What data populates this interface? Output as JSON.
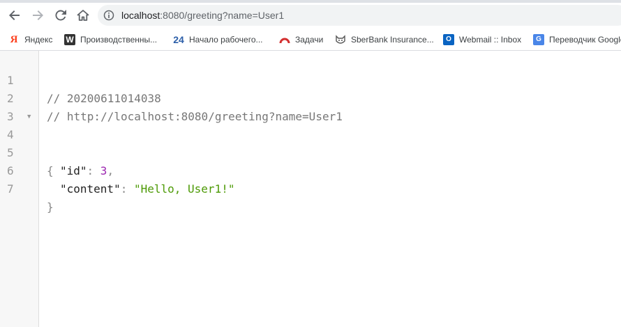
{
  "browser": {
    "url_host": "localhost",
    "url_path": ":8080/greeting?name=User1"
  },
  "bookmarks": [
    {
      "label": "Яндекс",
      "icon": "yandex-icon"
    },
    {
      "label": "Производственны...",
      "icon": "w-icon"
    },
    {
      "label": "Начало рабочего...",
      "icon": "bitrix24-icon"
    },
    {
      "label": "Задачи",
      "icon": "tasks-arc-icon"
    },
    {
      "label": "SberBank Insurance...",
      "icon": "cat-icon"
    },
    {
      "label": "Webmail :: Inbox",
      "icon": "outlook-icon"
    },
    {
      "label": "Переводчик Google",
      "icon": "google-translate-icon"
    }
  ],
  "code": {
    "line_numbers": [
      "1",
      "2",
      "3",
      "4",
      "5",
      "6",
      "7"
    ],
    "comment1": "// 20200611014038",
    "comment2": "// http://localhost:8080/greeting?name=User1",
    "open_brace": "{",
    "close_brace": "}",
    "id_key": "\"id\"",
    "id_value": "3",
    "content_key": "\"content\"",
    "content_value": "\"Hello, User1!\""
  },
  "colors": {
    "number": "#9c27b0",
    "string": "#4d9a06",
    "comment": "#777777"
  }
}
